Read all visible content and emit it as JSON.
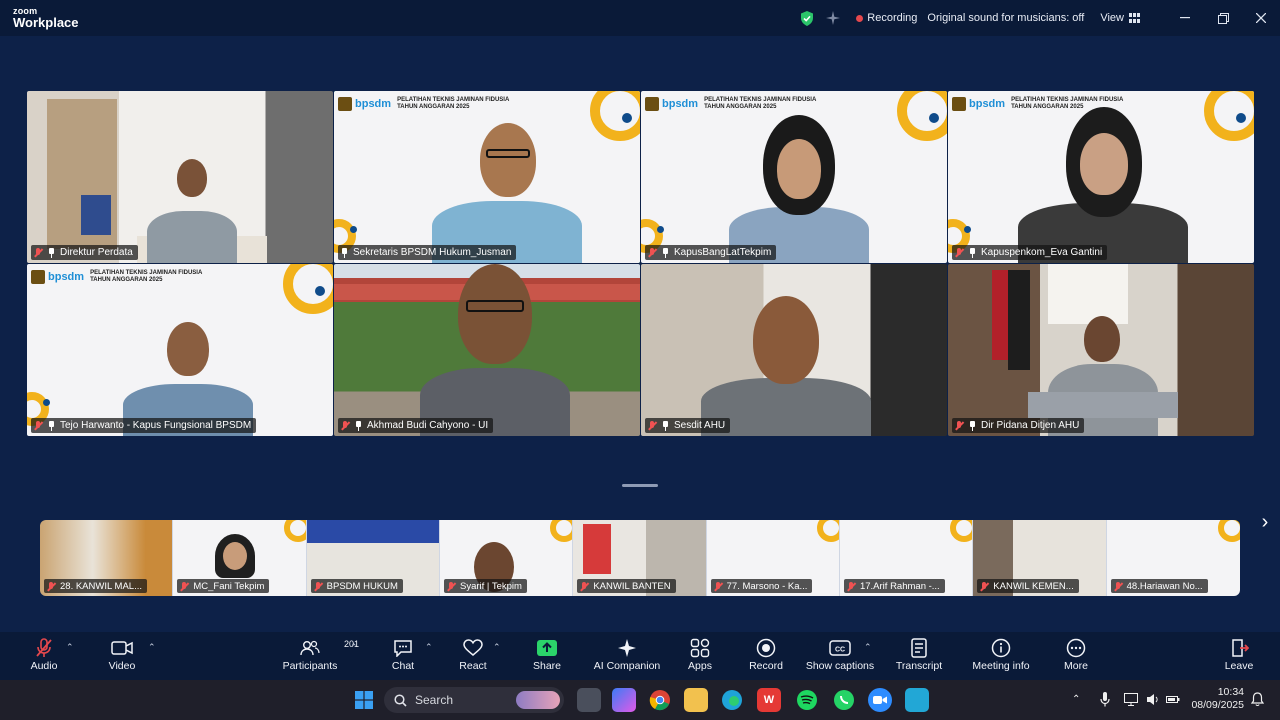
{
  "app": {
    "brand_line1": "zoom",
    "brand_line2": "Workplace"
  },
  "titlebar": {
    "recording": "Recording",
    "audio_mode": "Original sound for musicians: off",
    "view": "View"
  },
  "tile_banner": {
    "org": "bpsdm",
    "line1": "PELATIHAN TEKNIS JAMINAN FIDUSIA",
    "line2": "TAHUN ANGGARAN 2025"
  },
  "gallery": [
    {
      "name": "Direktur Perdata"
    },
    {
      "name": "Sekretaris BPSDM Hukum_Jusman"
    },
    {
      "name": "KapusBangLatTekpim"
    },
    {
      "name": "Kapuspenkom_Eva Gantini"
    },
    {
      "name": "Tejo Harwanto - Kapus Fungsional BPSDM"
    },
    {
      "name": "Akhmad Budi Cahyono - UI"
    },
    {
      "name": "Sesdit AHU"
    },
    {
      "name": "Dir Pidana Ditjen AHU"
    }
  ],
  "filmstrip": [
    {
      "name": "28. KANWIL MAL..."
    },
    {
      "name": "MC_Fani Tekpim"
    },
    {
      "name": "BPSDM HUKUM"
    },
    {
      "name": "Syarif | Tekpim"
    },
    {
      "name": "KANWIL BANTEN"
    },
    {
      "name": "77. Marsono - Ka..."
    },
    {
      "name": "17.Arif Rahman -..."
    },
    {
      "name": "KANWIL KEMEN..."
    },
    {
      "name": "48.Hariawan No..."
    }
  ],
  "toolbar": {
    "audio": "Audio",
    "video": "Video",
    "participants": "Participants",
    "participants_count": "201",
    "chat": "Chat",
    "react": "React",
    "share": "Share",
    "ai": "AI Companion",
    "apps": "Apps",
    "record": "Record",
    "captions": "Show captions",
    "transcript": "Transcript",
    "info": "Meeting info",
    "more": "More",
    "leave": "Leave"
  },
  "taskbar": {
    "search": "Search",
    "time": "10:34",
    "date": "08/09/2025"
  },
  "colors": {
    "toolbar_bg": "#0a1a38",
    "stage_bg": "#0d2148",
    "active_speaker": "#3ee0a0",
    "share_green": "#2bd46a",
    "leave_red": "#e5484d"
  }
}
